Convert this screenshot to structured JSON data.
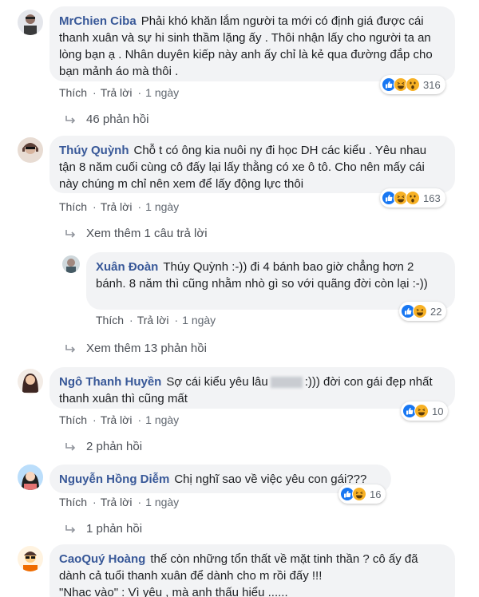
{
  "comments": [
    {
      "author": "MrChien Ciba",
      "text": "Phải khó khăn lắm người ta mới có định giá được cái thanh xuân và sự hi sinh thầm lặng ấy . Thôi nhận lấy cho người ta an lòng bạn ạ . Nhân duyên kiếp này anh ấy chỉ là kẻ qua đường đắp cho bạn mảnh áo mà thôi .",
      "like": "Thích",
      "reply": "Trả lời",
      "time": "1 ngày",
      "reactions": "316",
      "more": "46 phản hồi"
    },
    {
      "author": "Thúy Quỳnh",
      "text": "Chỗ t có ông kia nuôi ny đi học DH các kiểu . Yêu nhau tận 8 năm cuối cùng cô đấy lại lấy thằng có xe ô tô. Cho nên mấy cái này chúng m chỉ nên xem để lấy động lực thôi",
      "like": "Thích",
      "reply": "Trả lời",
      "time": "1 ngày",
      "reactions": "163",
      "more": "Xem thêm 1 câu trả lời"
    },
    {
      "author": "Xuân Đoàn",
      "text": "Thúy Quỳnh :-)) đi 4 bánh bao giờ chẳng hơn 2 bánh. 8 năm thì cũng nhằm nhò gì so với quãng đời còn lại :-))",
      "like": "Thích",
      "reply": "Trả lời",
      "time": "1 ngày",
      "reactions": "22",
      "more": "Xem thêm 13 phản hồi"
    },
    {
      "author": "Ngô Thanh Huyền",
      "text_before": "Sợ cái kiểu yêu lâu",
      "text_after": ":))) đời con gái đẹp nhất thanh xuân thì cũng mất",
      "like": "Thích",
      "reply": "Trả lời",
      "time": "1 ngày",
      "reactions": "10",
      "more": "2 phản hồi"
    },
    {
      "author": "Nguyễn Hồng Diễm",
      "text": "Chị nghĩ sao về việc yêu con gái???",
      "like": "Thích",
      "reply": "Trả lời",
      "time": "1 ngày",
      "reactions": "16",
      "more": "1 phản hồi"
    },
    {
      "author": "CaoQuý Hoàng",
      "text": "thế còn những tổn thất về mặt tinh thần ? cô ấy đã dành cả tuổi thanh xuân để dành cho m rồi đấy !!!",
      "text2": "\"Nhạc vào\" : Vì yêu , mà anh thấu hiểu ......"
    }
  ],
  "colors": {
    "author": "#385898",
    "bubble": "#f2f3f5",
    "like_blue": "#1877f2",
    "haha_yellow": "#f7b125"
  }
}
